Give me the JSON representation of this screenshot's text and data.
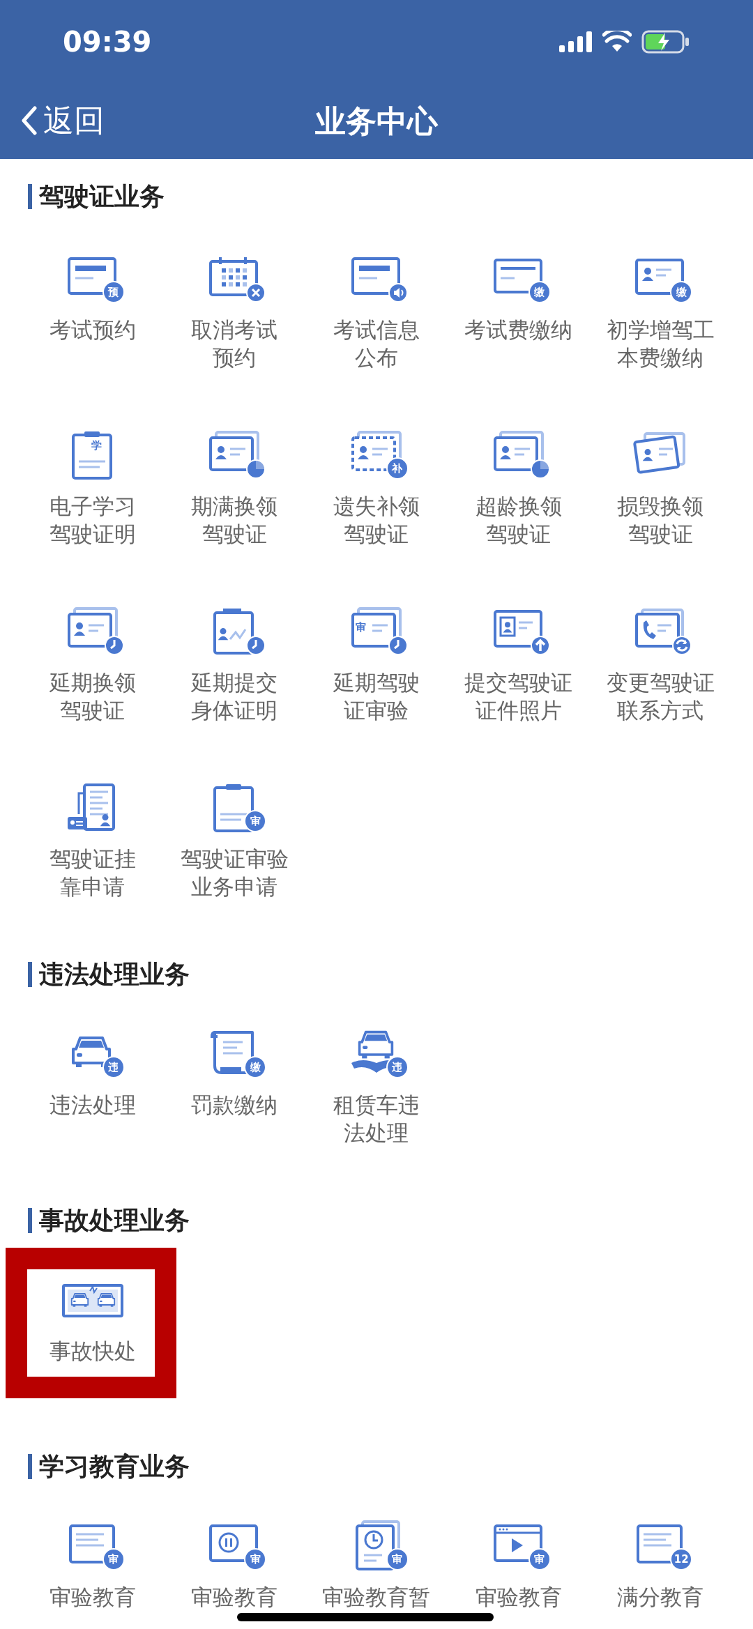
{
  "status_bar": {
    "time": "09:39"
  },
  "nav": {
    "back": "返回",
    "title": "业务中心"
  },
  "sections": [
    {
      "title": "驾驶证业务",
      "items": [
        {
          "lines": [
            "考试预约"
          ],
          "kind": "card",
          "badge": "预",
          "highlighted": false
        },
        {
          "lines": [
            "取消考试",
            "预约"
          ],
          "kind": "cancel",
          "highlighted": false
        },
        {
          "lines": [
            "考试信息",
            "公布"
          ],
          "kind": "notice",
          "highlighted": false
        },
        {
          "lines": [
            "考试费缴纳"
          ],
          "kind": "slim",
          "badge": "缴",
          "highlighted": false
        },
        {
          "lines": [
            "初学增驾工",
            "本费缴纳"
          ],
          "kind": "idcard",
          "badge": "缴",
          "highlighted": false
        },
        {
          "lines": [
            "电子学习",
            "驾驶证明"
          ],
          "kind": "clipboard",
          "inner": "学",
          "highlighted": false
        },
        {
          "lines": [
            "期满换领",
            "驾驶证"
          ],
          "kind": "renewal",
          "highlighted": false
        },
        {
          "lines": [
            "遗失补领",
            "驾驶证"
          ],
          "kind": "dashed",
          "badge": "补",
          "highlighted": false
        },
        {
          "lines": [
            "超龄换领",
            "驾驶证"
          ],
          "kind": "renewal",
          "highlighted": false
        },
        {
          "lines": [
            "损毁换领",
            "驾驶证"
          ],
          "kind": "tilted",
          "highlighted": false
        },
        {
          "lines": [
            "延期换领",
            "驾驶证"
          ],
          "kind": "overdue",
          "highlighted": false
        },
        {
          "lines": [
            "延期提交",
            "身体证明"
          ],
          "kind": "health",
          "highlighted": false
        },
        {
          "lines": [
            "延期驾驶",
            "证审验"
          ],
          "kind": "audit",
          "inner": "审",
          "highlighted": false
        },
        {
          "lines": [
            "提交驾驶证",
            "证件照片"
          ],
          "kind": "photo",
          "highlighted": false
        },
        {
          "lines": [
            "变更驾驶证",
            "联系方式"
          ],
          "kind": "contact",
          "highlighted": false
        },
        {
          "lines": [
            "驾驶证挂",
            "靠申请"
          ],
          "kind": "attach",
          "highlighted": false
        },
        {
          "lines": [
            "驾驶证审验",
            "业务申请"
          ],
          "kind": "clipboard",
          "badge": "审",
          "highlighted": false
        }
      ]
    },
    {
      "title": "违法处理业务",
      "items": [
        {
          "lines": [
            "违法处理"
          ],
          "kind": "car",
          "badge": "违",
          "highlighted": false
        },
        {
          "lines": [
            "罚款缴纳"
          ],
          "kind": "scroll",
          "badge": "缴",
          "highlighted": false
        },
        {
          "lines": [
            "租赁车违",
            "法处理"
          ],
          "kind": "handcar",
          "badge": "违",
          "highlighted": false
        }
      ]
    },
    {
      "title": "事故处理业务",
      "items": [
        {
          "lines": [
            "事故快处"
          ],
          "kind": "accident",
          "highlighted": true
        }
      ]
    },
    {
      "title": "学习教育业务",
      "items": [
        {
          "lines": [
            "审验教育"
          ],
          "kind": "doc",
          "badge": "审",
          "highlighted": false
        },
        {
          "lines": [
            "审验教育"
          ],
          "kind": "pause",
          "badge": "审",
          "highlighted": false
        },
        {
          "lines": [
            "审验教育暂"
          ],
          "kind": "clockdoc",
          "badge": "审",
          "highlighted": false
        },
        {
          "lines": [
            "审验教育"
          ],
          "kind": "video",
          "badge": "审",
          "highlighted": false
        },
        {
          "lines": [
            "满分教育"
          ],
          "kind": "doc",
          "badge": "12",
          "highlighted": false
        }
      ]
    }
  ]
}
